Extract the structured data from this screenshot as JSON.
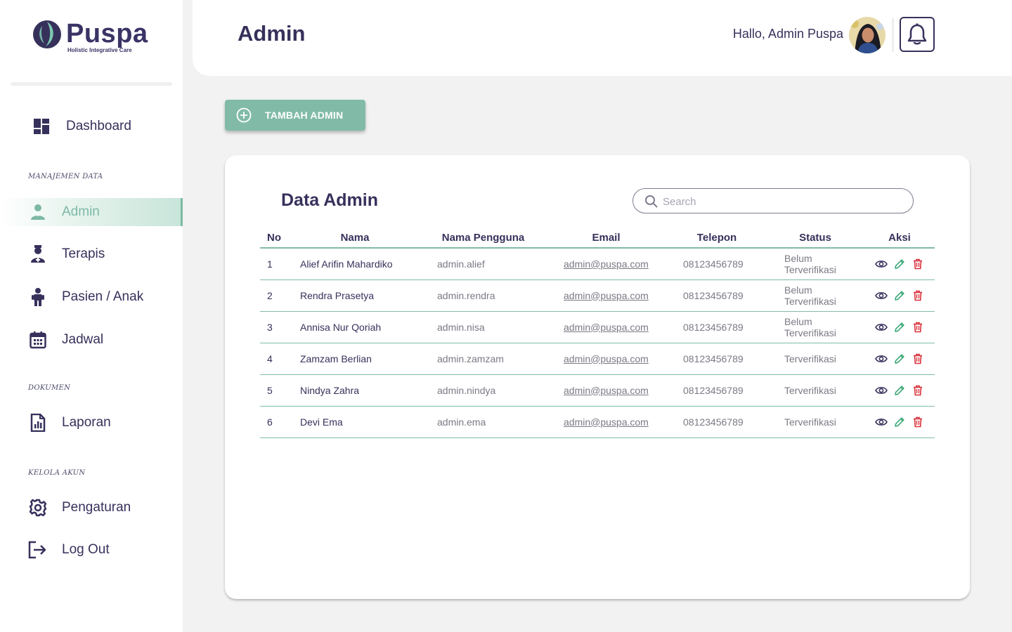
{
  "brand": {
    "name": "Puspa",
    "tagline": "Holistic Integrative Care"
  },
  "sidebar": {
    "items": [
      {
        "label": "Dashboard",
        "icon": "dashboard-icon"
      },
      {
        "label": "Admin",
        "icon": "admin-icon",
        "active": true
      },
      {
        "label": "Terapis",
        "icon": "therapist-icon"
      },
      {
        "label": "Pasien / Anak",
        "icon": "child-icon"
      },
      {
        "label": "Jadwal",
        "icon": "calendar-icon"
      },
      {
        "label": "Laporan",
        "icon": "report-icon"
      },
      {
        "label": "Pengaturan",
        "icon": "gear-icon"
      },
      {
        "label": "Log Out",
        "icon": "logout-icon"
      }
    ],
    "sections": [
      "MANAJEMEN DATA",
      "DOKUMEN",
      "KELOLA AKUN"
    ]
  },
  "header": {
    "title": "Admin",
    "greeting": "Hallo, Admin Puspa"
  },
  "add_button": {
    "label": "TAMBAH ADMIN"
  },
  "card": {
    "title": "Data Admin",
    "search_placeholder": "Search"
  },
  "table": {
    "headers": [
      "No",
      "Nama",
      "Nama Pengguna",
      "Email",
      "Telepon",
      "Status",
      "Aksi"
    ],
    "rows": [
      {
        "no": "1",
        "name": "Alief Arifin Mahardiko",
        "username": "admin.alief",
        "email": "admin@puspa.com",
        "phone": "08123456789",
        "status": "Belum Terverifikasi"
      },
      {
        "no": "2",
        "name": "Rendra Prasetya",
        "username": "admin.rendra",
        "email": "admin@puspa.com",
        "phone": "08123456789",
        "status": "Belum Terverifikasi"
      },
      {
        "no": "3",
        "name": "Annisa Nur Qoriah",
        "username": "admin.nisa",
        "email": "admin@puspa.com",
        "phone": "08123456789",
        "status": "Belum Terverifikasi"
      },
      {
        "no": "4",
        "name": "Zamzam Berlian",
        "username": "admin.zamzam",
        "email": "admin@puspa.com",
        "phone": "08123456789",
        "status": "Terverifikasi"
      },
      {
        "no": "5",
        "name": "Nindya Zahra",
        "username": "admin.nindya",
        "email": "admin@puspa.com",
        "phone": "08123456789",
        "status": "Terverifikasi"
      },
      {
        "no": "6",
        "name": "Devi Ema",
        "username": "admin.ema",
        "email": "admin@puspa.com",
        "phone": "08123456789",
        "status": "Terverifikasi"
      }
    ]
  },
  "colors": {
    "primary": "#36315b",
    "accent": "#81bba8",
    "danger": "#d9303a",
    "edit": "#3aa775"
  }
}
